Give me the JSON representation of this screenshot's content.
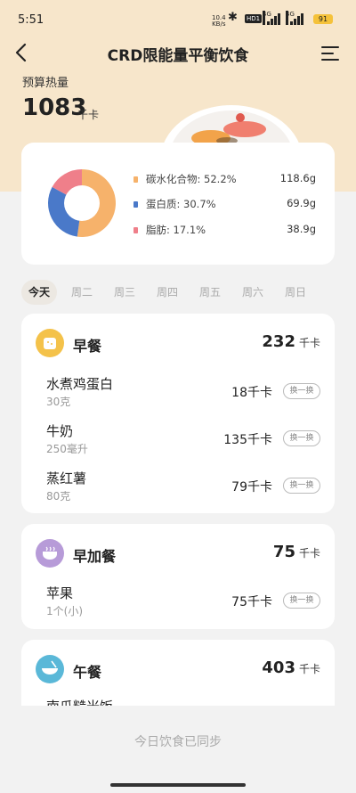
{
  "status_bar": {
    "time": "5:51",
    "net_speed_value": "10.4",
    "net_speed_unit": "KB/s",
    "hd": "HD1",
    "sig1": "4G",
    "sig2": "4G",
    "battery": "91"
  },
  "header": {
    "title": "CRD限能量平衡饮食"
  },
  "budget": {
    "label": "预算热量",
    "value": "1083",
    "unit": "千卡"
  },
  "macros": {
    "donut": [
      {
        "name": "碳水化合物",
        "percent": 52.2,
        "color": "#f6b26b"
      },
      {
        "name": "蛋白质",
        "percent": 30.7,
        "color": "#4a79c9"
      },
      {
        "name": "脂肪",
        "percent": 17.1,
        "color": "#ef7f8a"
      }
    ],
    "rows": [
      {
        "label": "碳水化合物: 52.2%",
        "value": "118.6g",
        "color": "#f6b26b"
      },
      {
        "label": "蛋白质: 30.7%",
        "value": "69.9g",
        "color": "#4a79c9"
      },
      {
        "label": "脂肪: 17.1%",
        "value": "38.9g",
        "color": "#ef7f8a"
      }
    ]
  },
  "days": [
    "今天",
    "周二",
    "周三",
    "周四",
    "周五",
    "周六",
    "周日"
  ],
  "kcal_unit": "千卡",
  "swap_label": "换一换",
  "meals": [
    {
      "name": "早餐",
      "kcal": "232",
      "foods": [
        {
          "name": "水煮鸡蛋白",
          "amount": "30克",
          "kcal": "18千卡"
        },
        {
          "name": "牛奶",
          "amount": "250毫升",
          "kcal": "135千卡"
        },
        {
          "name": "蒸红薯",
          "amount": "80克",
          "kcal": "79千卡"
        }
      ]
    },
    {
      "name": "早加餐",
      "kcal": "75",
      "foods": [
        {
          "name": "苹果",
          "amount": "1个(小)",
          "kcal": "75千卡"
        }
      ]
    },
    {
      "name": "午餐",
      "kcal": "403",
      "foods": [
        {
          "name": "南瓜糙米饭",
          "amount": "",
          "kcal": ""
        }
      ]
    }
  ],
  "footer": {
    "sync_text": "今日饮食已同步"
  }
}
